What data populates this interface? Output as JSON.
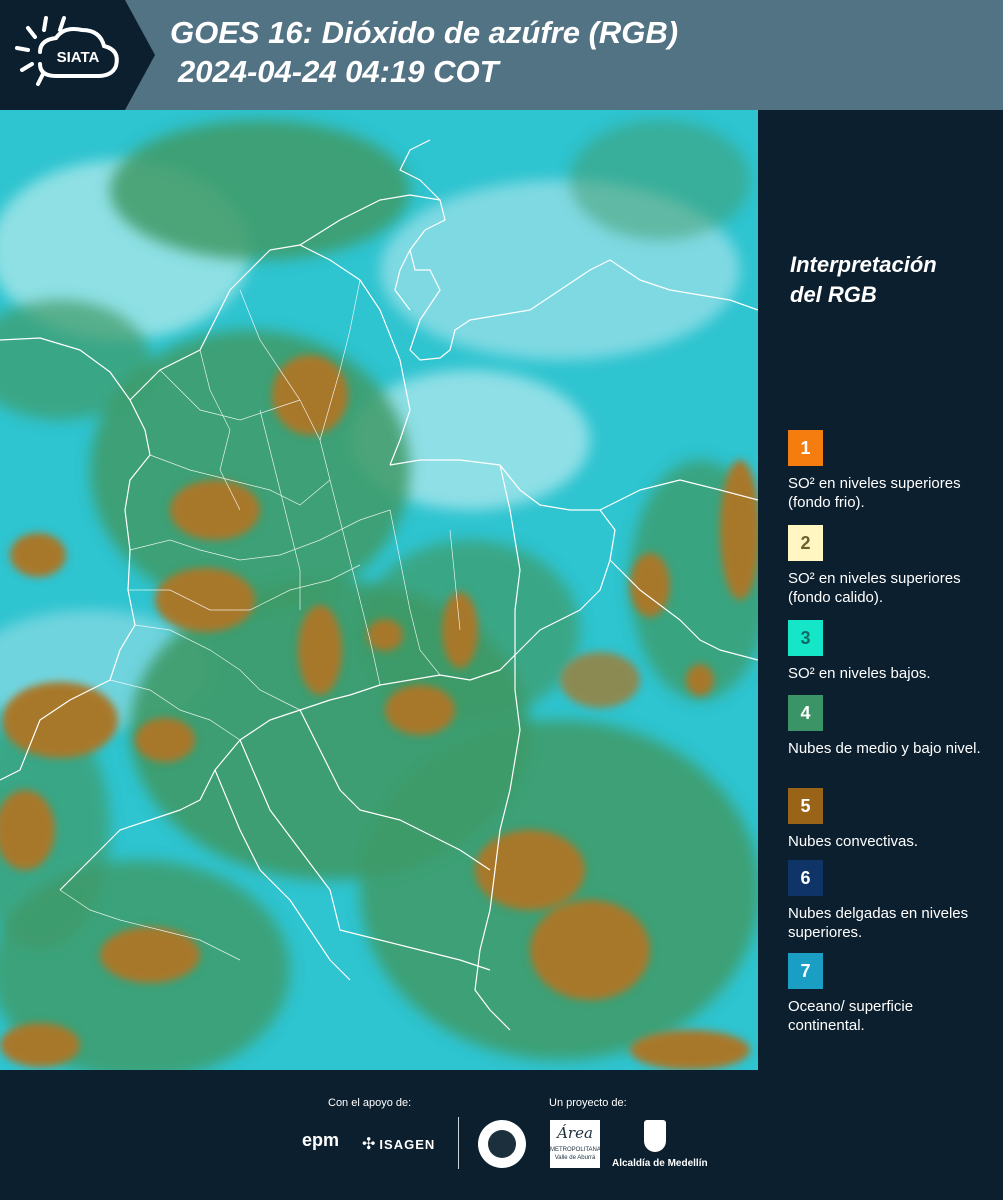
{
  "header": {
    "title_line1": "GOES 16: Dióxido de azúfre (RGB)",
    "title_line2": "2024-04-24 04:19 COT",
    "logo_text": "SIATA"
  },
  "legend": {
    "title_line1": "Interpretación",
    "title_line2": "del RGB",
    "items": [
      {
        "number": "1",
        "color": "#f57c0f",
        "text_color": "#ffffff",
        "description": "SO² en niveles superiores (fondo frio)."
      },
      {
        "number": "2",
        "color": "#fff6c2",
        "text_color": "#6b6030",
        "description": "SO² en niveles superiores (fondo calido)."
      },
      {
        "number": "3",
        "color": "#16e6c8",
        "text_color": "#0d6b66",
        "description": "SO² en niveles bajos."
      },
      {
        "number": "4",
        "color": "#3a9466",
        "text_color": "#ffffff",
        "description": "Nubes de medio y bajo nivel."
      },
      {
        "number": "5",
        "color": "#9a6418",
        "text_color": "#ffffff",
        "description": "Nubes convectivas."
      },
      {
        "number": "6",
        "color": "#0f3468",
        "text_color": "#ffffff",
        "description": "Nubes delgadas en niveles superiores."
      },
      {
        "number": "7",
        "color": "#1a9ec4",
        "text_color": "#ffffff",
        "description": "Oceano/ superficie continental."
      }
    ]
  },
  "footer": {
    "support_label": "Con el apoyo de:",
    "project_label": "Un proyecto de:",
    "sponsor_epm": "epm",
    "sponsor_isagen": "ISAGEN",
    "partner_area_line1": "METROPOLITANA",
    "partner_area_line2": "Valle de Aburrá",
    "partner_alcaldia": "Alcaldía de Medellín"
  },
  "colors": {
    "background": "#0c1f2e",
    "header_bar": "#527384",
    "map_cyan": "#2ec4d0",
    "map_green": "#3f9a66",
    "convective_brown": "#a8782a"
  }
}
